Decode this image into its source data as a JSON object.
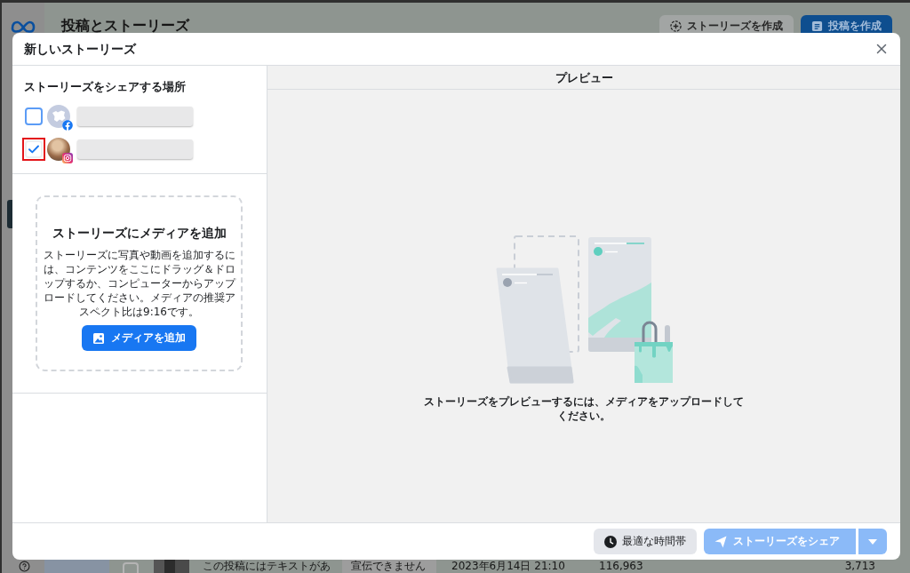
{
  "background_page": {
    "title": "投稿とストーリーズ",
    "header_buttons": [
      {
        "label": "ストーリーズを作成",
        "kind": "secondary"
      },
      {
        "label": "投稿を作成",
        "kind": "primary"
      }
    ],
    "post_row": {
      "checked": false,
      "cells": [
        {
          "kind": "text",
          "text": "この投稿にはテキストがあ"
        },
        {
          "kind": "badge",
          "text": "宣伝できません"
        },
        {
          "kind": "text",
          "text": "2023年6月14日 21:10"
        },
        {
          "kind": "number",
          "text": "116,963"
        },
        {
          "kind": "number",
          "text": "3,713"
        }
      ]
    }
  },
  "dialog": {
    "title": "新しいストーリーズ",
    "share_to": {
      "heading": "ストーリーズをシェアする場所",
      "accounts": [
        {
          "kind": "facebook",
          "checked": false,
          "annotated": false
        },
        {
          "kind": "instagram",
          "checked": true,
          "annotated": true
        }
      ]
    },
    "media": {
      "title": "ストーリーズにメディアを追加",
      "description": "ストーリーズに写真や動画を追加するには、コンテンツをここにドラッグ＆ドロップするか、コンピューターからアップロードしてください。メディアの推奨アスペクト比は9:16です。",
      "button": "メディアを追加"
    },
    "preview": {
      "heading": "プレビュー",
      "message": "ストーリーズをプレビューするには、メディアをアップロードしてください。"
    },
    "footer": {
      "schedule_button": "最適な時間帯",
      "share_button": {
        "label": "ストーリーズをシェア",
        "disabled": true
      }
    }
  }
}
